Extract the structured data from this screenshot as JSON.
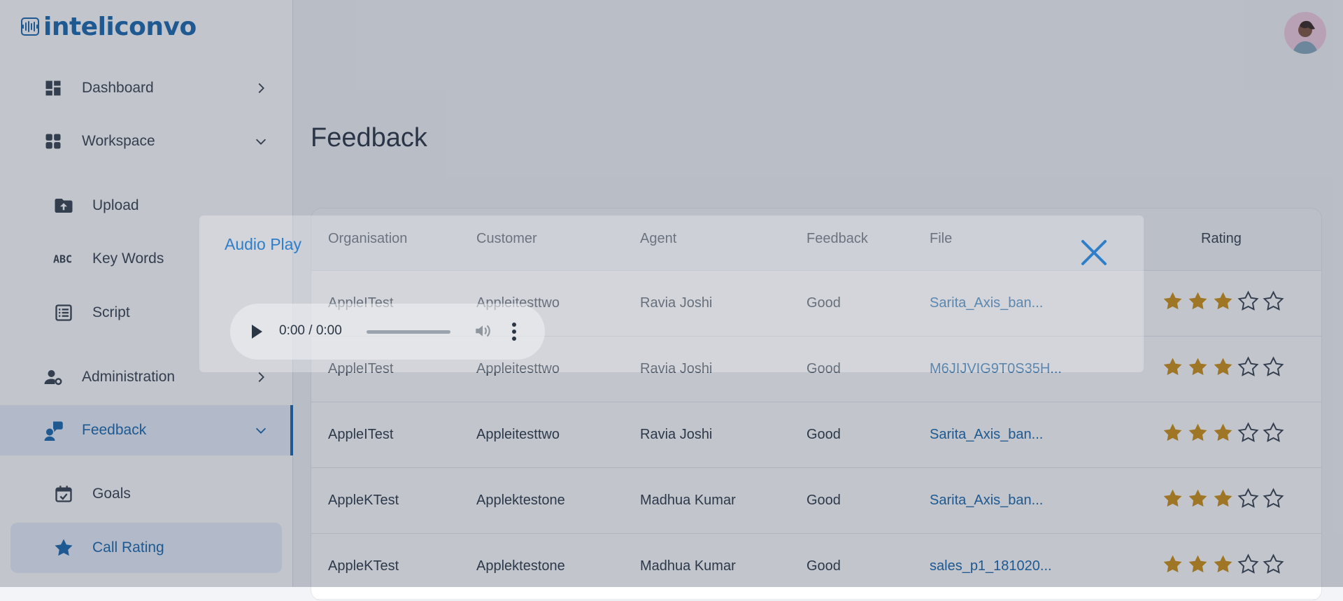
{
  "brand": {
    "name": "inteliconvo"
  },
  "sidebar": {
    "items": [
      {
        "label": "Dashboard"
      },
      {
        "label": "Workspace"
      },
      {
        "label": "Upload"
      },
      {
        "label": "Key Words"
      },
      {
        "label": "Script"
      },
      {
        "label": "Administration"
      },
      {
        "label": "Feedback"
      },
      {
        "label": "Goals"
      },
      {
        "label": "Call Rating"
      }
    ]
  },
  "page": {
    "title": "Feedback"
  },
  "table": {
    "headers": {
      "organisation": "Organisation",
      "customer": "Customer",
      "agent": "Agent",
      "feedback": "Feedback",
      "file": "File",
      "rating": "Rating"
    },
    "rows": [
      {
        "organisation": "AppleITest",
        "customer": "Appleitesttwo",
        "agent": "Ravia Joshi",
        "feedback": "Good",
        "file": "Sarita_Axis_ban...",
        "rating": 3
      },
      {
        "organisation": "AppleITest",
        "customer": "Appleitesttwo",
        "agent": "Ravia Joshi",
        "feedback": "Good",
        "file": "M6JIJVIG9T0S35H...",
        "rating": 3
      },
      {
        "organisation": "AppleITest",
        "customer": "Appleitesttwo",
        "agent": "Ravia Joshi",
        "feedback": "Good",
        "file": "Sarita_Axis_ban...",
        "rating": 3
      },
      {
        "organisation": "AppleKTest",
        "customer": "Applektestone",
        "agent": "Madhua Kumar",
        "feedback": "Good",
        "file": "Sarita_Axis_ban...",
        "rating": 3
      },
      {
        "organisation": "AppleKTest",
        "customer": "Applektestone",
        "agent": "Madhua Kumar",
        "feedback": "Good",
        "file": "sales_p1_181020...",
        "rating": 3
      }
    ],
    "max_rating": 5
  },
  "modal": {
    "title": "Audio Play",
    "player": {
      "time": "0:00 / 0:00"
    }
  },
  "colors": {
    "accent": "#0b5ea8",
    "star": "#c98a06",
    "modal_title": "#2e7ec9"
  }
}
